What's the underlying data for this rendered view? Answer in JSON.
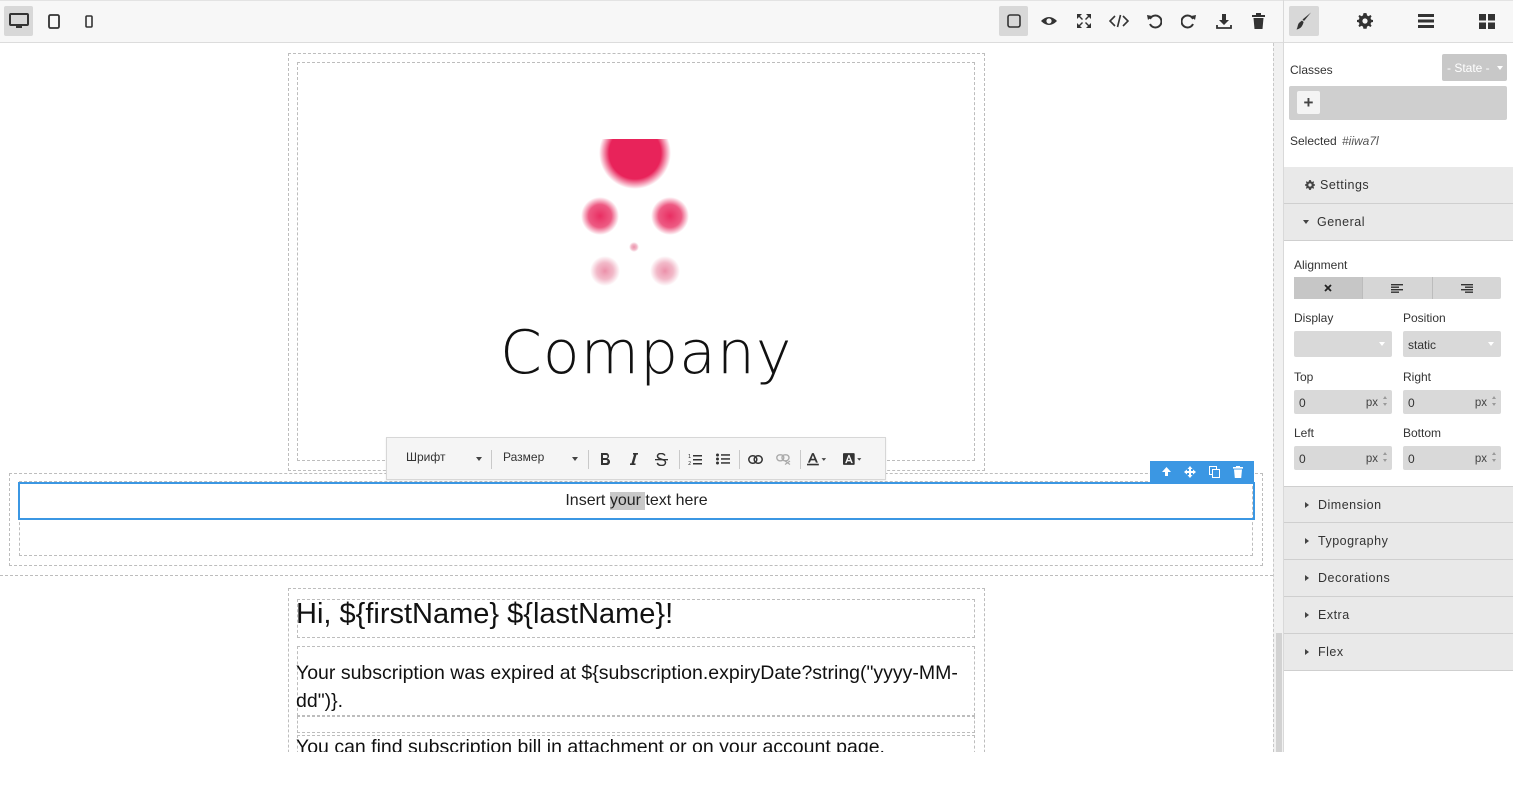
{
  "toolbar": {
    "devices": [
      "desktop-icon",
      "tablet-icon",
      "mobile-icon"
    ],
    "actions": [
      "sw-visibility-icon",
      "preview-icon",
      "fullscreen-icon",
      "code-icon",
      "undo-icon",
      "redo-icon",
      "export-icon",
      "clear-canvas-icon"
    ]
  },
  "panel_tabs": [
    "style-manager-icon",
    "trait-settings-icon",
    "layer-manager-icon",
    "blocks-icon"
  ],
  "canvas": {
    "logo_text": "Company",
    "rte": {
      "font_label": "Шрифт",
      "size_label": "Размер"
    },
    "selected_text": {
      "before": "Insert ",
      "highlight": "your ",
      "after": "text here"
    },
    "greeting": "Hi, ${firstName} ${lastName}!",
    "paragraph1": "Your subscription was expired at ${subscription.expiryDate?string(\"yyyy-MM-dd\")}.",
    "paragraph2": "You can find subscription bill in attachment or on your account page."
  },
  "style_manager": {
    "classes_label": "Classes",
    "state_select": "- State -",
    "add_class": "+",
    "selected_label": "Selected",
    "selected_id": "#iiwa7l",
    "settings_section": "Settings",
    "general_section": "General",
    "alignment_label": "Alignment",
    "display_label": "Display",
    "display_value": "",
    "position_label": "Position",
    "position_value": "static",
    "top_label": "Top",
    "top_value": "0",
    "right_label": "Right",
    "right_value": "0",
    "left_label": "Left",
    "left_value": "0",
    "bottom_label": "Bottom",
    "bottom_value": "0",
    "unit": "px",
    "sections": [
      "Dimension",
      "Typography",
      "Decorations",
      "Extra",
      "Flex"
    ]
  },
  "colors": {
    "accent": "#3b97e3",
    "logo_pink": "#e8235a"
  }
}
